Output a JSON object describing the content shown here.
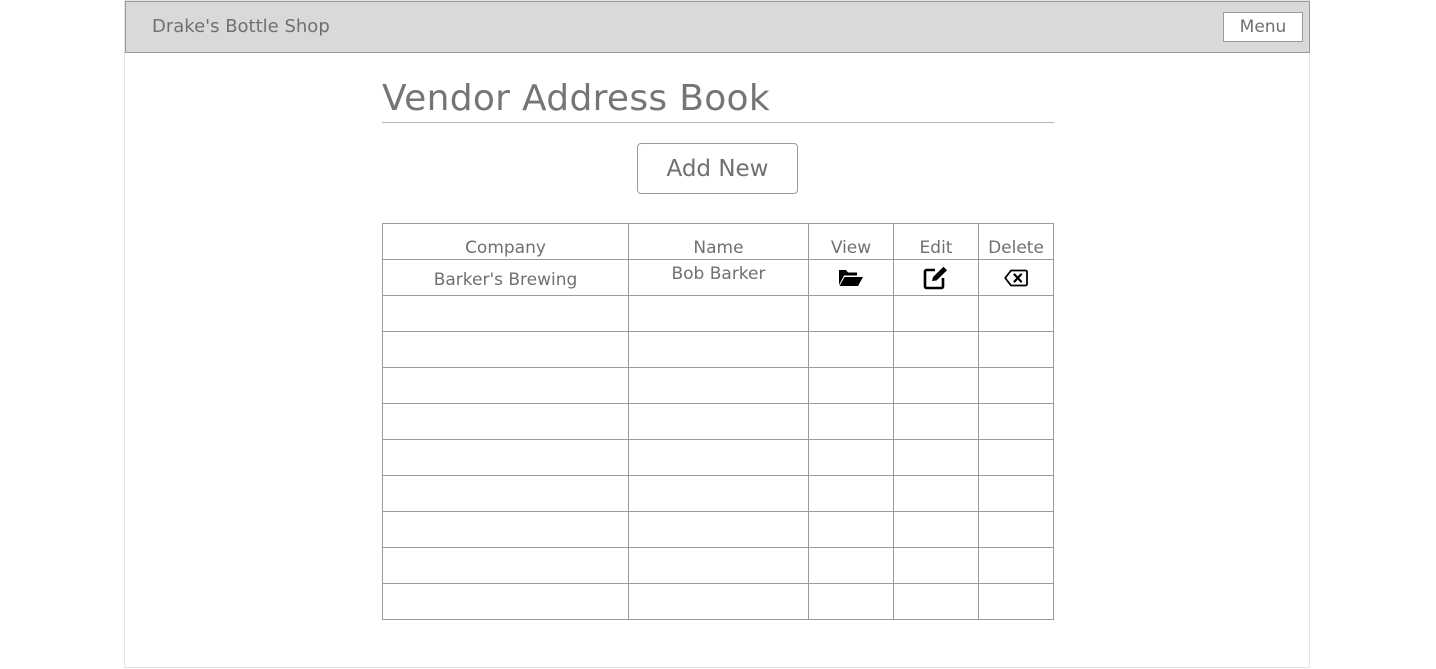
{
  "header": {
    "shop_name": "Drake's Bottle Shop",
    "menu_label": "Menu"
  },
  "page": {
    "title": "Vendor Address Book",
    "add_new_label": "Add New"
  },
  "table": {
    "columns": [
      "Company",
      "Name",
      "View",
      "Edit",
      "Delete"
    ],
    "rows": [
      {
        "company": "Barker's Brewing",
        "name": "Bob Barker",
        "view_icon": "folder-open-icon",
        "edit_icon": "edit-icon",
        "delete_icon": "backspace-delete-icon"
      }
    ],
    "empty_rows": 9
  },
  "colors": {
    "topbar_bg": "#d9d9d9",
    "border": "#9a9a9a",
    "text": "#707070",
    "icon": "#000000"
  }
}
